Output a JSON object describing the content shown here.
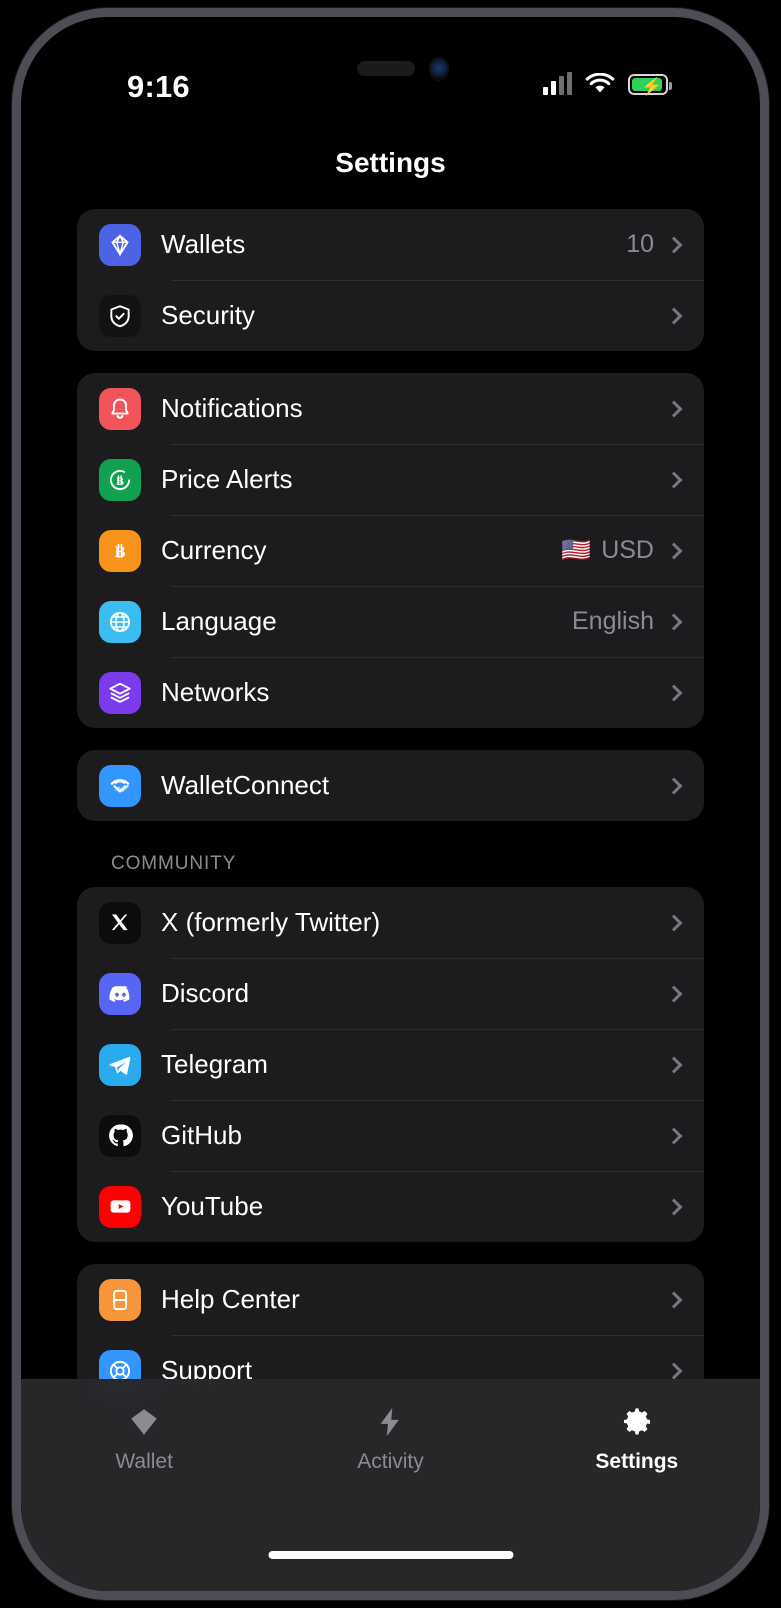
{
  "status_bar": {
    "time": "9:16",
    "signal_icon": "cellular-bars-icon",
    "wifi_icon": "wifi-icon",
    "battery_icon": "battery-charging-icon"
  },
  "header": {
    "title": "Settings"
  },
  "colors": {
    "page_background": "#000000",
    "card_background": "#1c1c1e",
    "separator": "#2e2e31",
    "primary_text": "#ffffff",
    "secondary_text": "#8b8b90",
    "wallets_icon": "#4c63e6",
    "security_icon": "#121214",
    "notifications_icon": "#f2545b",
    "price_alerts_icon": "#12a150",
    "currency_icon": "#f7931a",
    "language_icon": "#3bbdef",
    "networks_icon": "#7c3aed",
    "walletconnect_icon": "#3396ff",
    "x_icon": "#0c0c0e",
    "discord_icon": "#5865f2",
    "telegram_icon": "#2aabee",
    "github_icon": "#0c0c0e",
    "youtube_icon": "#ff0000",
    "help_center_icon": "#f7953a",
    "support_icon": "#3396ff",
    "battery_fill": "#2fd158"
  },
  "groups": [
    {
      "id": "account-group",
      "label": null,
      "rows": [
        {
          "id": "wallets",
          "label": "Wallets",
          "value": "10",
          "flag": null,
          "icon": "diamond-icon"
        },
        {
          "id": "security",
          "label": "Security",
          "value": null,
          "flag": null,
          "icon": "shield-check-icon"
        }
      ]
    },
    {
      "id": "preferences-group",
      "label": null,
      "rows": [
        {
          "id": "notifications",
          "label": "Notifications",
          "value": null,
          "flag": null,
          "icon": "bell-icon"
        },
        {
          "id": "price-alerts",
          "label": "Price Alerts",
          "value": null,
          "flag": null,
          "icon": "bitcoin-circle-icon"
        },
        {
          "id": "currency",
          "label": "Currency",
          "value": "USD",
          "flag": "🇺🇸",
          "icon": "bitcoin-icon"
        },
        {
          "id": "language",
          "label": "Language",
          "value": "English",
          "flag": null,
          "icon": "globe-icon"
        },
        {
          "id": "networks",
          "label": "Networks",
          "value": null,
          "flag": null,
          "icon": "layers-icon"
        }
      ]
    },
    {
      "id": "walletconnect-group",
      "label": null,
      "rows": [
        {
          "id": "walletconnect",
          "label": "WalletConnect",
          "value": null,
          "flag": null,
          "icon": "walletconnect-icon"
        }
      ]
    },
    {
      "id": "community-group",
      "label": "COMMUNITY",
      "rows": [
        {
          "id": "x-twitter",
          "label": "X (formerly Twitter)",
          "value": null,
          "flag": null,
          "icon": "x-icon"
        },
        {
          "id": "discord",
          "label": "Discord",
          "value": null,
          "flag": null,
          "icon": "discord-icon"
        },
        {
          "id": "telegram",
          "label": "Telegram",
          "value": null,
          "flag": null,
          "icon": "telegram-icon"
        },
        {
          "id": "github",
          "label": "GitHub",
          "value": null,
          "flag": null,
          "icon": "github-icon"
        },
        {
          "id": "youtube",
          "label": "YouTube",
          "value": null,
          "flag": null,
          "icon": "youtube-icon"
        }
      ]
    },
    {
      "id": "help-group",
      "label": null,
      "rows": [
        {
          "id": "help-center",
          "label": "Help Center",
          "value": null,
          "flag": null,
          "icon": "book-icon"
        },
        {
          "id": "support",
          "label": "Support",
          "value": null,
          "flag": null,
          "icon": "lifebuoy-icon"
        }
      ]
    }
  ],
  "tab_bar": {
    "tabs": [
      {
        "id": "wallet",
        "label": "Wallet",
        "icon": "diamond-icon",
        "active": false
      },
      {
        "id": "activity",
        "label": "Activity",
        "icon": "bolt-icon",
        "active": false
      },
      {
        "id": "settings",
        "label": "Settings",
        "icon": "gear-icon",
        "active": true
      }
    ]
  }
}
